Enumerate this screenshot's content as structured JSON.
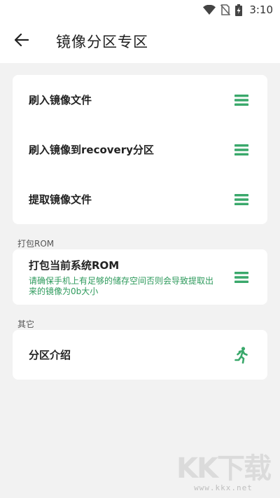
{
  "status_bar": {
    "time": "3:10",
    "icons": [
      "wifi-icon",
      "no-sim-icon",
      "battery-charging-icon"
    ]
  },
  "app_bar": {
    "title": "镜像分区专区",
    "back_icon": "arrow-back-icon"
  },
  "card1": {
    "items": [
      {
        "label": "刷入镜像文件",
        "icon": "menu-icon"
      },
      {
        "label": "刷入镜像到recovery分区",
        "icon": "menu-icon"
      },
      {
        "label": "提取镜像文件",
        "icon": "menu-icon"
      }
    ]
  },
  "section_pack": {
    "label": "打包ROM",
    "item": {
      "label": "打包当前系统ROM",
      "description": "请确保手机上有足够的储存空间否则会导致提取出来的镜像为0b大小",
      "icon": "menu-icon"
    }
  },
  "section_other": {
    "label": "其它",
    "item": {
      "label": "分区介绍",
      "icon": "running-person-icon"
    }
  },
  "watermark": {
    "logo": "KK下载",
    "url": "www.kkx.net"
  },
  "colors": {
    "accent": "#3aa86b",
    "description": "#2e9a5c",
    "background": "#f2f2f2",
    "card": "#ffffff"
  }
}
